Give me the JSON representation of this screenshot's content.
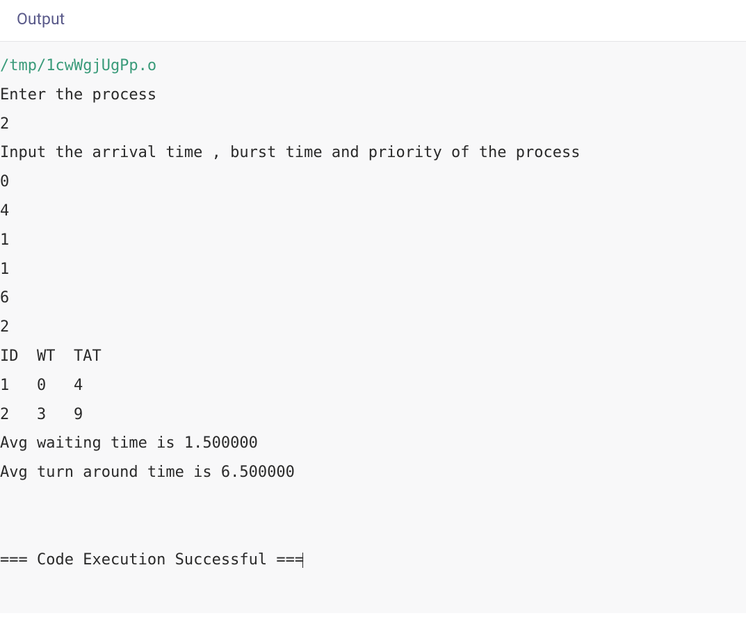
{
  "header": {
    "title": "Output"
  },
  "output": {
    "path": "/tmp/1cwWgjUgPp.o",
    "lines": [
      "Enter the process",
      "2",
      "Input the arrival time , burst time and priority of the process",
      "0",
      "4",
      "1",
      "1",
      "6",
      "2",
      "ID  WT  TAT",
      "1   0   4",
      "2   3   9",
      "Avg waiting time is 1.500000",
      "Avg turn around time is 6.500000",
      "",
      "",
      "=== Code Execution Successful ==="
    ]
  }
}
